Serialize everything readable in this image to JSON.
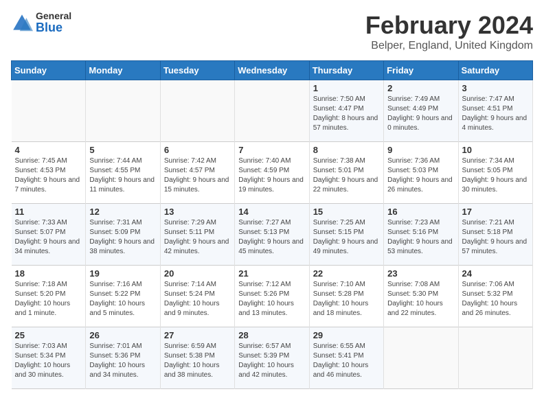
{
  "header": {
    "logo_general": "General",
    "logo_blue": "Blue",
    "title": "February 2024",
    "subtitle": "Belper, England, United Kingdom"
  },
  "calendar": {
    "days_of_week": [
      "Sunday",
      "Monday",
      "Tuesday",
      "Wednesday",
      "Thursday",
      "Friday",
      "Saturday"
    ],
    "weeks": [
      [
        {
          "day": "",
          "content": ""
        },
        {
          "day": "",
          "content": ""
        },
        {
          "day": "",
          "content": ""
        },
        {
          "day": "",
          "content": ""
        },
        {
          "day": "1",
          "content": "Sunrise: 7:50 AM\nSunset: 4:47 PM\nDaylight: 8 hours and 57 minutes."
        },
        {
          "day": "2",
          "content": "Sunrise: 7:49 AM\nSunset: 4:49 PM\nDaylight: 9 hours and 0 minutes."
        },
        {
          "day": "3",
          "content": "Sunrise: 7:47 AM\nSunset: 4:51 PM\nDaylight: 9 hours and 4 minutes."
        }
      ],
      [
        {
          "day": "4",
          "content": "Sunrise: 7:45 AM\nSunset: 4:53 PM\nDaylight: 9 hours and 7 minutes."
        },
        {
          "day": "5",
          "content": "Sunrise: 7:44 AM\nSunset: 4:55 PM\nDaylight: 9 hours and 11 minutes."
        },
        {
          "day": "6",
          "content": "Sunrise: 7:42 AM\nSunset: 4:57 PM\nDaylight: 9 hours and 15 minutes."
        },
        {
          "day": "7",
          "content": "Sunrise: 7:40 AM\nSunset: 4:59 PM\nDaylight: 9 hours and 19 minutes."
        },
        {
          "day": "8",
          "content": "Sunrise: 7:38 AM\nSunset: 5:01 PM\nDaylight: 9 hours and 22 minutes."
        },
        {
          "day": "9",
          "content": "Sunrise: 7:36 AM\nSunset: 5:03 PM\nDaylight: 9 hours and 26 minutes."
        },
        {
          "day": "10",
          "content": "Sunrise: 7:34 AM\nSunset: 5:05 PM\nDaylight: 9 hours and 30 minutes."
        }
      ],
      [
        {
          "day": "11",
          "content": "Sunrise: 7:33 AM\nSunset: 5:07 PM\nDaylight: 9 hours and 34 minutes."
        },
        {
          "day": "12",
          "content": "Sunrise: 7:31 AM\nSunset: 5:09 PM\nDaylight: 9 hours and 38 minutes."
        },
        {
          "day": "13",
          "content": "Sunrise: 7:29 AM\nSunset: 5:11 PM\nDaylight: 9 hours and 42 minutes."
        },
        {
          "day": "14",
          "content": "Sunrise: 7:27 AM\nSunset: 5:13 PM\nDaylight: 9 hours and 45 minutes."
        },
        {
          "day": "15",
          "content": "Sunrise: 7:25 AM\nSunset: 5:15 PM\nDaylight: 9 hours and 49 minutes."
        },
        {
          "day": "16",
          "content": "Sunrise: 7:23 AM\nSunset: 5:16 PM\nDaylight: 9 hours and 53 minutes."
        },
        {
          "day": "17",
          "content": "Sunrise: 7:21 AM\nSunset: 5:18 PM\nDaylight: 9 hours and 57 minutes."
        }
      ],
      [
        {
          "day": "18",
          "content": "Sunrise: 7:18 AM\nSunset: 5:20 PM\nDaylight: 10 hours and 1 minute."
        },
        {
          "day": "19",
          "content": "Sunrise: 7:16 AM\nSunset: 5:22 PM\nDaylight: 10 hours and 5 minutes."
        },
        {
          "day": "20",
          "content": "Sunrise: 7:14 AM\nSunset: 5:24 PM\nDaylight: 10 hours and 9 minutes."
        },
        {
          "day": "21",
          "content": "Sunrise: 7:12 AM\nSunset: 5:26 PM\nDaylight: 10 hours and 13 minutes."
        },
        {
          "day": "22",
          "content": "Sunrise: 7:10 AM\nSunset: 5:28 PM\nDaylight: 10 hours and 18 minutes."
        },
        {
          "day": "23",
          "content": "Sunrise: 7:08 AM\nSunset: 5:30 PM\nDaylight: 10 hours and 22 minutes."
        },
        {
          "day": "24",
          "content": "Sunrise: 7:06 AM\nSunset: 5:32 PM\nDaylight: 10 hours and 26 minutes."
        }
      ],
      [
        {
          "day": "25",
          "content": "Sunrise: 7:03 AM\nSunset: 5:34 PM\nDaylight: 10 hours and 30 minutes."
        },
        {
          "day": "26",
          "content": "Sunrise: 7:01 AM\nSunset: 5:36 PM\nDaylight: 10 hours and 34 minutes."
        },
        {
          "day": "27",
          "content": "Sunrise: 6:59 AM\nSunset: 5:38 PM\nDaylight: 10 hours and 38 minutes."
        },
        {
          "day": "28",
          "content": "Sunrise: 6:57 AM\nSunset: 5:39 PM\nDaylight: 10 hours and 42 minutes."
        },
        {
          "day": "29",
          "content": "Sunrise: 6:55 AM\nSunset: 5:41 PM\nDaylight: 10 hours and 46 minutes."
        },
        {
          "day": "",
          "content": ""
        },
        {
          "day": "",
          "content": ""
        }
      ]
    ]
  }
}
